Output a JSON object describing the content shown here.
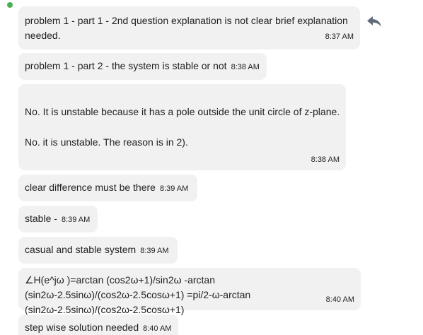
{
  "messages": [
    {
      "text": "problem 1 - part 1 - 2nd question explanation is not clear brief explanation needed.",
      "time": "8:37 AM"
    },
    {
      "text": "problem 1 - part 2 - the system is stable or not",
      "time": "8:38 AM"
    },
    {
      "lines": [
        "No. It is unstable because it has a pole outside the unit circle of z-plane.",
        "No. it is unstable. The reason is in 2)."
      ],
      "time": "8:38 AM"
    },
    {
      "text": "clear difference must be there",
      "time": "8:39 AM"
    },
    {
      "text": "stable -",
      "time": "8:39 AM"
    },
    {
      "text": "casual and stable system",
      "time": "8:39 AM"
    },
    {
      "text": "∠H(e^jω )=arctan (cos2ω+1)/sin2ω -arctan (sin2ω-2.5sinω)/(cos2ω-2.5cosω+1) =pi/2-ω-arctan (sin2ω-2.5sinω)/(cos2ω-2.5cosω+1)",
      "time": "8:40 AM"
    },
    {
      "text": "step wise solution needed",
      "time": "8:40 AM"
    }
  ],
  "icons": {
    "reply": "reply-icon",
    "status": "online-status-dot"
  },
  "colors": {
    "bubble": "#f1f1f1",
    "status": "#4caf50",
    "icon": "#5f6b7a"
  }
}
